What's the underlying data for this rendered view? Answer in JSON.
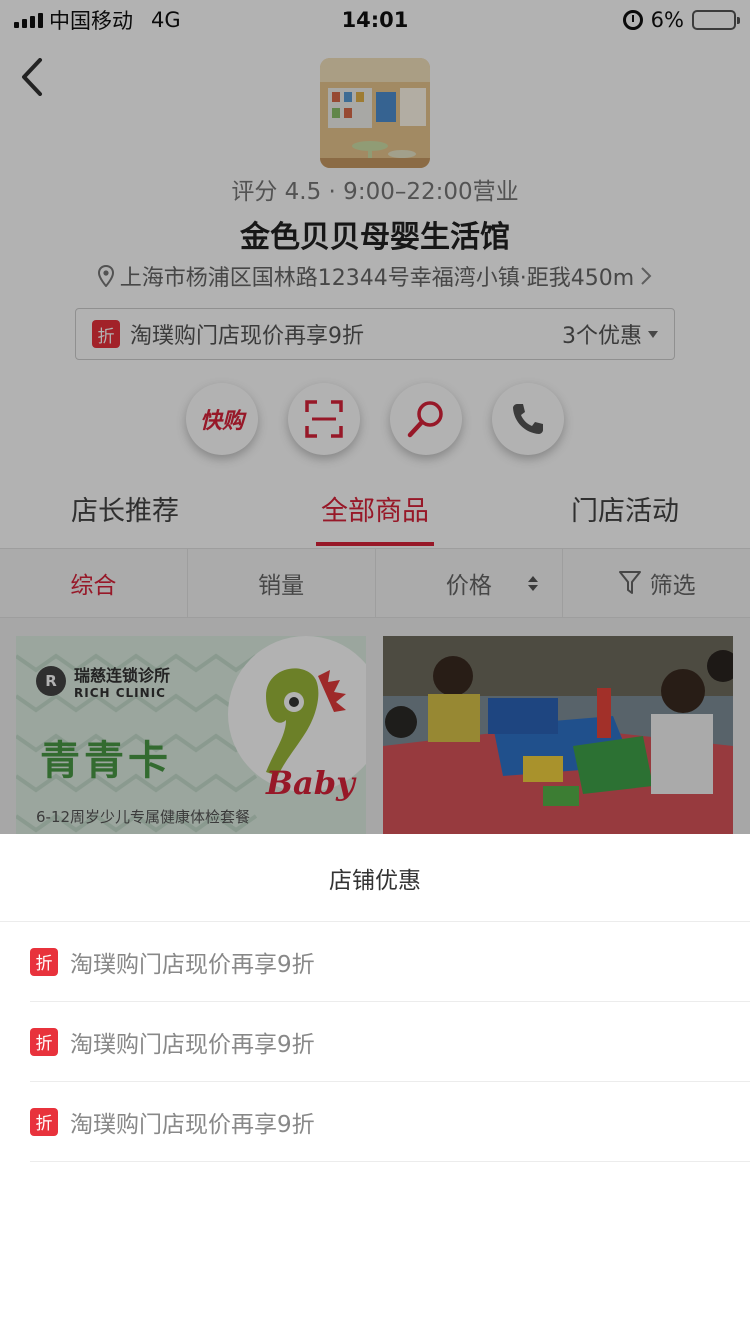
{
  "status_bar": {
    "carrier": "中国移动",
    "network": "4G",
    "time": "14:01",
    "battery_percent": "6%",
    "battery_level": 0.06
  },
  "store": {
    "meta": "评分 4.5 · 9:00–22:00营业",
    "name": "金色贝贝母婴生活馆",
    "address": "上海市杨浦区国林路12344号幸福湾小镇·距我450m",
    "promo_badge": "折",
    "promo_text": "淘璞购门店现价再享9折",
    "promo_count": "3个优惠"
  },
  "actions": {
    "kuaigou_label": "快购"
  },
  "tabs": [
    "店长推荐",
    "全部商品",
    "门店活动"
  ],
  "sort": {
    "comprehensive": "综合",
    "sales": "销量",
    "price": "价格",
    "filter": "筛选"
  },
  "products": {
    "left": {
      "clinic_logo": "R",
      "clinic_name": "瑞慈连锁诊所",
      "clinic_name_en": "RICH CLINIC",
      "title": "青青卡",
      "caption": "6-12周岁少儿专属健康体检套餐",
      "logo_text": "Baby"
    }
  },
  "sheet": {
    "title": "店铺优惠",
    "offers": [
      {
        "badge": "折",
        "text": "淘璞购门店现价再享9折"
      },
      {
        "badge": "折",
        "text": "淘璞购门店现价再享9折"
      },
      {
        "badge": "折",
        "text": "淘璞购门店现价再享9折"
      }
    ]
  },
  "colors": {
    "accent": "#d8233a",
    "badge": "#e8323c",
    "overlay": "rgba(0,0,0,0.3)"
  }
}
